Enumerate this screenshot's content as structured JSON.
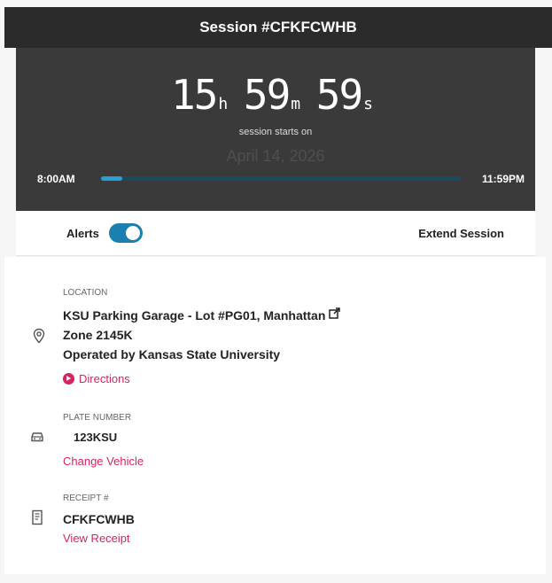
{
  "header": {
    "title": "Session #CFKFCWHB"
  },
  "timer": {
    "hours": "15",
    "hours_unit": "h",
    "minutes": "59",
    "minutes_unit": "m",
    "seconds": "59",
    "seconds_unit": "s",
    "starts_label": "session starts on",
    "start_date": "April 14, 2026",
    "start_time": "8:00AM",
    "end_time": "11:59PM",
    "progress_fraction": 0.06
  },
  "controls": {
    "alerts_label": "Alerts",
    "alerts_on": true,
    "extend_label": "Extend Session"
  },
  "location": {
    "label": "LOCATION",
    "name": "KSU Parking Garage - Lot #PG01, Manhattan",
    "zone": "Zone 2145K",
    "operator": "Operated by Kansas State University",
    "directions_label": "Directions",
    "icon": "location-pin-icon"
  },
  "plate": {
    "label": "PLATE NUMBER",
    "value": "123KSU",
    "change_label": "Change Vehicle",
    "icon": "car-icon"
  },
  "receipt": {
    "label": "RECEIPT #",
    "value": "CFKFCWHB",
    "view_label": "View Receipt",
    "icon": "receipt-icon"
  },
  "colors": {
    "accent": "#d6245e",
    "toggle": "#1b7fb0",
    "progress": "#2a9fd6",
    "dark": "#3a3a3a"
  }
}
